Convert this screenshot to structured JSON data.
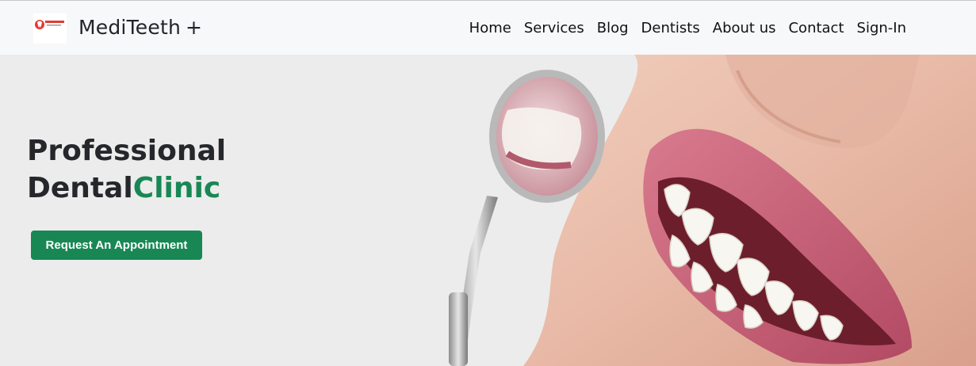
{
  "brand": {
    "name": "MediTeeth",
    "plus": "+",
    "logo_icon": "tooth-logo-icon",
    "logo_text": "MEDITEETH"
  },
  "nav": {
    "items": [
      "Home",
      "Services",
      "Blog",
      "Dentists",
      "About us",
      "Contact",
      "Sign-In"
    ]
  },
  "hero": {
    "title_line1": "Professional",
    "title_line2_main": "Dental",
    "title_line2_accent": "Clinic",
    "cta_label": "Request An Appointment",
    "image": "smiling-mouth-with-dental-mirror"
  },
  "colors": {
    "accent": "#198754",
    "navbar_bg": "#f7f8fa",
    "hero_bg": "#ececec",
    "text_dark": "#25272b"
  }
}
